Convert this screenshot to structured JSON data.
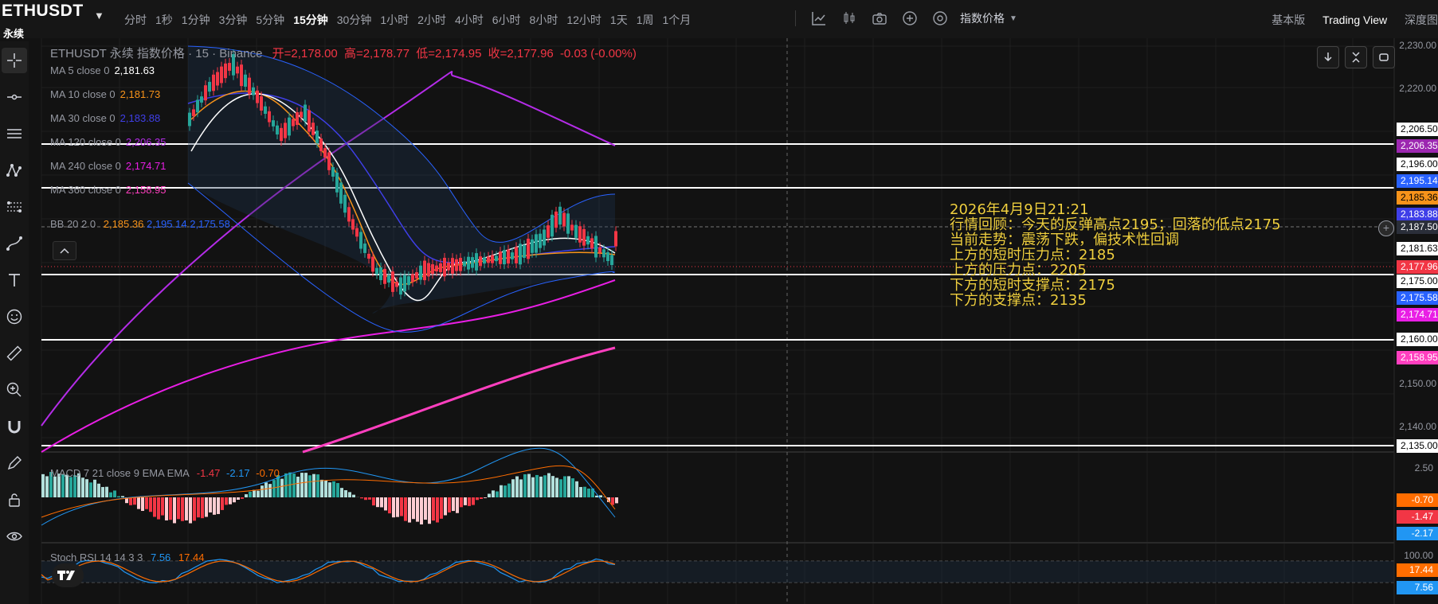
{
  "header": {
    "symbol": "ETHUSDT",
    "symbol_sub": "永续",
    "intervals": [
      "分时",
      "1秒",
      "1分钟",
      "3分钟",
      "5分钟",
      "15分钟",
      "30分钟",
      "1小时",
      "2小时",
      "4小时",
      "6小时",
      "8小时",
      "12小时",
      "1天",
      "1周",
      "1个月"
    ],
    "active_interval": "15分钟",
    "index_price_label": "指数价格",
    "view_basic": "基本版",
    "view_tradingview": "Trading View",
    "view_depth": "深度图"
  },
  "legend": {
    "title": "ETHUSDT 永续 指数价格 · 15 · Binance",
    "open_label": "开=",
    "open": "2,178.00",
    "high_label": "高=",
    "high": "2,178.77",
    "low_label": "低=",
    "low": "2,174.95",
    "close_label": "收=",
    "close": "2,177.96",
    "change": "-0.03 (-0.00%)"
  },
  "indicators": [
    {
      "label": "MA 5 close 0",
      "value": "2,181.63",
      "color": "#ffffff"
    },
    {
      "label": "MA 10 close 0",
      "value": "2,181.73",
      "color": "#f7931a"
    },
    {
      "label": "MA 30 close 0",
      "value": "2,183.88",
      "color": "#3f3fe8"
    },
    {
      "label": "MA 120 close 0",
      "value": "2,206.35",
      "color": "#b42ce8"
    },
    {
      "label": "MA 240 close 0",
      "value": "2,174.71",
      "color": "#e91ee5"
    },
    {
      "label": "MA 360 close 0",
      "value": "2,158.95",
      "color": "#ff3fbf"
    }
  ],
  "bb": {
    "label": "BB 20 2 0",
    "basis": "2,185.36",
    "upper": "2,195.14",
    "lower": "2,175.58"
  },
  "macd": {
    "label": "MACD 7 21 close 9 EMA EMA",
    "hist": "-1.47",
    "macd": "-2.17",
    "signal": "-0.70"
  },
  "stoch": {
    "label": "Stoch RSI 14 14 3 3",
    "k": "7.56",
    "d": "17.44"
  },
  "annotation": [
    "2026年4月9日21:21",
    "行情回顾：今天的反弹高点2195；回落的低点2175",
    "当前走势：震荡下跌，偏技术性回调",
    "上方的短时压力点：2185",
    "上方的压力点：2205",
    "下方的短时支撑点：2175",
    "下方的支撑点：2135"
  ],
  "price_scale": [
    {
      "text": "2,230.00"
    },
    {
      "text": "2,220.00"
    },
    {
      "text": "2,150.00"
    },
    {
      "text": "2,140.00"
    }
  ],
  "price_tags": [
    {
      "text": "2,206.50",
      "bg": "#ffffff",
      "fg": "#000000"
    },
    {
      "text": "2,206.35",
      "bg": "#9c27b0",
      "fg": "#ffffff"
    },
    {
      "text": "2,196.00",
      "bg": "#ffffff",
      "fg": "#000000"
    },
    {
      "text": "2,195.14",
      "bg": "#2962ff",
      "fg": "#ffffff"
    },
    {
      "text": "2,185.36",
      "bg": "#f7931a",
      "fg": "#000000"
    },
    {
      "text": "2,183.88",
      "bg": "#3f3fe8",
      "fg": "#ffffff"
    },
    {
      "text": "2,187.50",
      "bg": "#2a2e39",
      "fg": "#ffffff"
    },
    {
      "text": "2,181.63",
      "bg": "#ffffff",
      "fg": "#000000"
    },
    {
      "text": "2,177.96",
      "bg": "#f23645",
      "fg": "#ffffff"
    },
    {
      "text": "2,175.00",
      "bg": "#ffffff",
      "fg": "#000000"
    },
    {
      "text": "2,175.58",
      "bg": "#2962ff",
      "fg": "#ffffff"
    },
    {
      "text": "2,174.71",
      "bg": "#e91ee5",
      "fg": "#ffffff"
    },
    {
      "text": "2,160.00",
      "bg": "#ffffff",
      "fg": "#000000"
    },
    {
      "text": "2,158.95",
      "bg": "#ff3fbf",
      "fg": "#ffffff"
    },
    {
      "text": "2,135.00",
      "bg": "#ffffff",
      "fg": "#000000"
    }
  ],
  "macd_scale": {
    "top": "2.50",
    "signal": "-0.70",
    "hist": "-1.47",
    "macd": "-2.17"
  },
  "stoch_scale": {
    "top": "100.00",
    "d": "17.44",
    "k": "7.56"
  },
  "colors": {
    "up": "#26a69a",
    "down": "#f23645",
    "bg": "#121212"
  }
}
